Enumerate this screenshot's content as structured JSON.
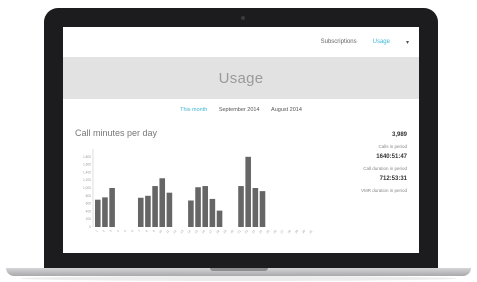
{
  "window": {
    "nav": [
      "Subscriptions",
      "Usage"
    ],
    "active_nav": "Usage",
    "caret": "▾"
  },
  "page": {
    "title": "Usage"
  },
  "tabs": [
    "This month",
    "September 2014",
    "August 2014"
  ],
  "active_tab": "This month",
  "chart_title": "Call minutes per day",
  "stats": [
    {
      "value": "3,989",
      "label": "Calls in period"
    },
    {
      "value": "1640:51:47",
      "label": "Call duration in period"
    },
    {
      "value": "712:53:31",
      "label": "VMR duration in period"
    }
  ],
  "chart_data": {
    "type": "bar",
    "title": "Call minutes per day",
    "categories": [
      "1",
      "2",
      "3",
      "4",
      "5",
      "6",
      "7",
      "8",
      "9",
      "10",
      "11",
      "12",
      "13",
      "14",
      "15",
      "16",
      "17",
      "18",
      "19",
      "20",
      "21",
      "22",
      "23",
      "24",
      "25",
      "26",
      "27",
      "28",
      "29",
      "30",
      "31"
    ],
    "values": [
      700,
      760,
      1000,
      0,
      0,
      0,
      750,
      800,
      1050,
      1250,
      880,
      0,
      0,
      680,
      1020,
      1050,
      720,
      420,
      0,
      0,
      1050,
      1800,
      1000,
      920,
      0,
      0,
      0,
      0,
      0,
      0,
      0
    ],
    "ylim": [
      0,
      2000
    ],
    "yticks": [
      "1,800",
      "1,600",
      "1,400",
      "1,200",
      "1,000",
      "800",
      "600",
      "400",
      "200",
      "0"
    ],
    "bar_color": "#666666",
    "grid": false
  },
  "colors": {
    "accent": "#3fb6d6",
    "hero_bg": "#e2e2e2",
    "bar": "#666666"
  }
}
